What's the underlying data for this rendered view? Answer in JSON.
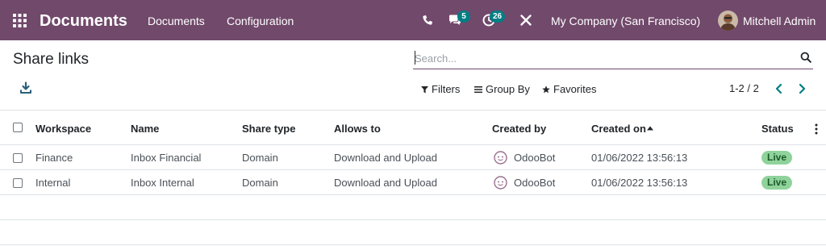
{
  "navbar": {
    "brand": "Documents",
    "menu": [
      "Documents",
      "Configuration"
    ],
    "messages_badge": "5",
    "activities_badge": "26",
    "company": "My Company (San Francisco)",
    "user": "Mitchell Admin",
    "bg_color": "#71496b",
    "badge_color": "#017e84"
  },
  "control_panel": {
    "title": "Share links",
    "search_placeholder": "Search...",
    "filters_label": "Filters",
    "group_by_label": "Group By",
    "favorites_label": "Favorites",
    "pager_text": "1-2 / 2"
  },
  "table": {
    "columns": [
      "Workspace",
      "Name",
      "Share type",
      "Allows to",
      "Created by",
      "Created on",
      "Status"
    ],
    "rows": [
      {
        "workspace": "Finance",
        "name": "Inbox Financial",
        "share_type": "Domain",
        "allows_to": "Download and Upload",
        "created_by": "OdooBot",
        "created_on": "01/06/2022 13:56:13",
        "status": "Live"
      },
      {
        "workspace": "Internal",
        "name": "Inbox Internal",
        "share_type": "Domain",
        "allows_to": "Download and Upload",
        "created_by": "OdooBot",
        "created_on": "01/06/2022 13:56:13",
        "status": "Live"
      }
    ],
    "status_color": "#8fd39b"
  }
}
